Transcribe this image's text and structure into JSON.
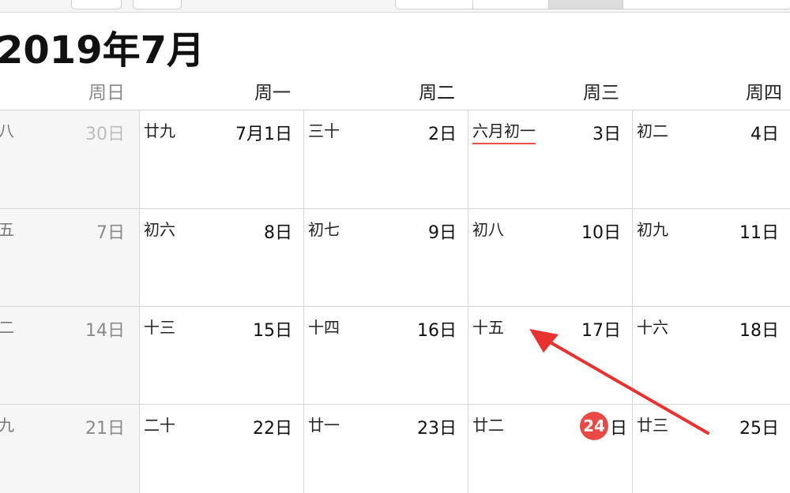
{
  "month_title": "2019年7月",
  "weekdays": [
    "周日",
    "周一",
    "周二",
    "周三",
    "周四"
  ],
  "rows": [
    {
      "cells": [
        {
          "lunar": "八",
          "day": "30日"
        },
        {
          "lunar": "廿九",
          "day": "7月1日"
        },
        {
          "lunar": "三十",
          "day": "2日"
        },
        {
          "lunar": "六月初一",
          "day": "3日"
        },
        {
          "lunar": "初二",
          "day": "4日"
        }
      ]
    },
    {
      "cells": [
        {
          "lunar": "五",
          "day": "7日"
        },
        {
          "lunar": "初六",
          "day": "8日"
        },
        {
          "lunar": "初七",
          "day": "9日"
        },
        {
          "lunar": "初八",
          "day": "10日"
        },
        {
          "lunar": "初九",
          "day": "11日"
        }
      ]
    },
    {
      "cells": [
        {
          "lunar": "二",
          "day": "14日"
        },
        {
          "lunar": "十三",
          "day": "15日"
        },
        {
          "lunar": "十四",
          "day": "16日"
        },
        {
          "lunar": "十五",
          "day": "17日"
        },
        {
          "lunar": "十六",
          "day": "18日"
        }
      ]
    },
    {
      "cells": [
        {
          "lunar": "九",
          "day": "21日"
        },
        {
          "lunar": "二十",
          "day": "22日"
        },
        {
          "lunar": "廿一",
          "day": "23日"
        },
        {
          "lunar": "廿二",
          "today_number": "24",
          "today_suffix": "日"
        },
        {
          "lunar": "廿三",
          "day": "25日"
        }
      ]
    }
  ],
  "colors": {
    "today_badge": "#ea4a43",
    "annotation_arrow": "#e8322f",
    "lunar_month_underline": "#e8524a"
  }
}
